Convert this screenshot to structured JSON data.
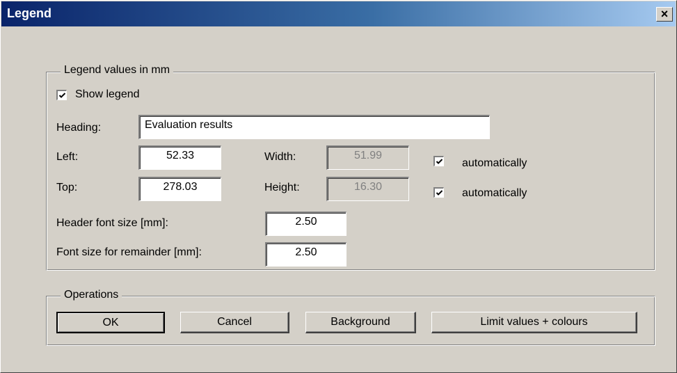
{
  "window": {
    "title": "Legend",
    "close_glyph": "×"
  },
  "legend_group": {
    "caption": "Legend values in mm",
    "show_legend": {
      "label": "Show legend",
      "checked": true
    },
    "heading": {
      "label": "Heading:",
      "value": "Evaluation results"
    },
    "left": {
      "label": "Left:",
      "value": "52.33"
    },
    "top": {
      "label": "Top:",
      "value": "278.03"
    },
    "width": {
      "label": "Width:",
      "value": "51.99",
      "auto_label": "automatically",
      "auto_checked": true
    },
    "height": {
      "label": "Height:",
      "value": "16.30",
      "auto_label": "automatically",
      "auto_checked": true
    },
    "header_font": {
      "label": "Header font size [mm]:",
      "value": "2.50"
    },
    "remainder_font": {
      "label": "Font size for remainder [mm]:",
      "value": "2.50"
    }
  },
  "operations_group": {
    "caption": "Operations",
    "buttons": {
      "ok": "OK",
      "cancel": "Cancel",
      "background": "Background",
      "limit": "Limit values + colours"
    }
  },
  "icons": {
    "checkmark": "checkmark-icon",
    "close": "close-icon"
  }
}
